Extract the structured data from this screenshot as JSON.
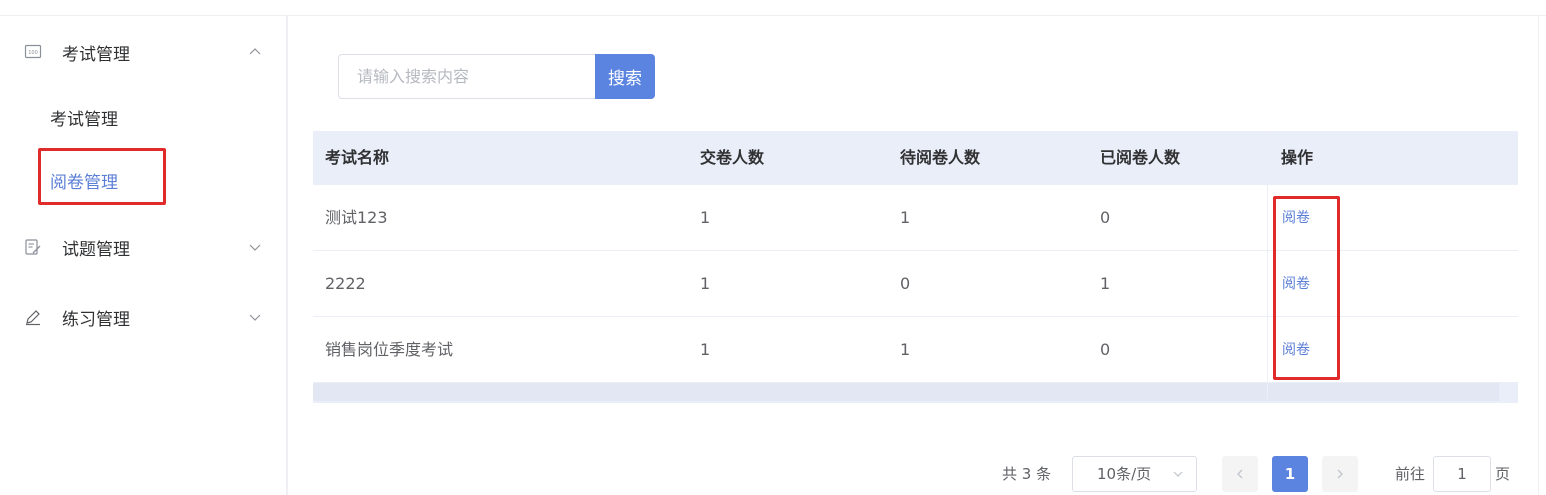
{
  "sidebar": {
    "groups": [
      {
        "label": "考试管理",
        "icon": "exam-icon",
        "expanded": true
      },
      {
        "label": "试题管理",
        "icon": "question-edit-icon",
        "expanded": false
      },
      {
        "label": "练习管理",
        "icon": "pencil-icon",
        "expanded": false
      }
    ],
    "sub_items": [
      {
        "label": "考试管理",
        "active": false
      },
      {
        "label": "阅卷管理",
        "active": true
      }
    ]
  },
  "search": {
    "placeholder": "请输入搜索内容",
    "value": "",
    "button_label": "搜索"
  },
  "table": {
    "columns": [
      "考试名称",
      "交卷人数",
      "待阅卷人数",
      "已阅卷人数",
      "操作"
    ],
    "rows": [
      {
        "name": "测试123",
        "submitted": "1",
        "pending": "1",
        "graded": "0",
        "action": "阅卷"
      },
      {
        "name": "2222",
        "submitted": "1",
        "pending": "0",
        "graded": "1",
        "action": "阅卷"
      },
      {
        "name": "销售岗位季度考试",
        "submitted": "1",
        "pending": "1",
        "graded": "0",
        "action": "阅卷"
      }
    ]
  },
  "pagination": {
    "total_text": "共 3 条",
    "page_size": "10条/页",
    "current_page": "1",
    "goto_prefix": "前往",
    "goto_value": "1",
    "goto_suffix": "页"
  },
  "colors": {
    "accent": "#5b84e0",
    "active_link": "#5b7fd6",
    "header_bg": "#e9eef9",
    "highlight_box": "#e02b2b"
  }
}
